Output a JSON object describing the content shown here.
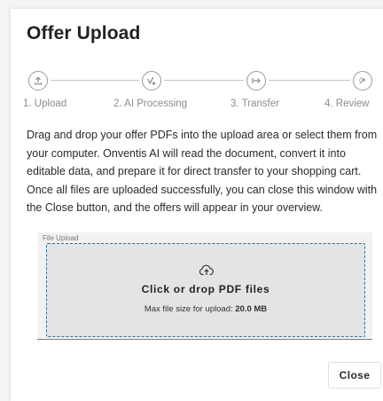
{
  "dialog": {
    "title": "Offer Upload",
    "description": "Drag and drop your offer PDFs into the upload area or select them from your computer. Onventis AI will read the document, convert it into editable data, and prepare it for direct transfer to your shopping cart. Once all files are uploaded successfully, you can close this window with the Close button, and the offers will appear in your overview."
  },
  "stepper": {
    "steps": [
      {
        "label": "1. Upload",
        "icon": "upload-icon"
      },
      {
        "label": "2. AI Processing",
        "icon": "ai-sparkle-icon"
      },
      {
        "label": "3. Transfer",
        "icon": "transfer-arrow-icon"
      },
      {
        "label": "4. Review",
        "icon": "review-icon"
      }
    ]
  },
  "upload": {
    "field_label": "File Upload",
    "drop_title": "Click or drop PDF files",
    "max_size_prefix": "Max file size for upload:",
    "max_size_value": "20.0 MB"
  },
  "footer": {
    "close_label": "Close"
  },
  "colors": {
    "drop_border": "#2f6e96",
    "drop_background": "#e4e4e4",
    "step_icon": "#9a9a9a"
  }
}
